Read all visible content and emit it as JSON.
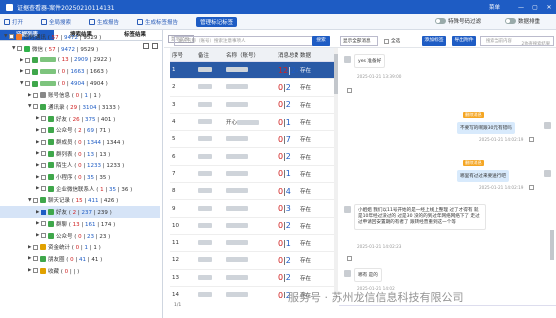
{
  "window": {
    "title": "证据查看器-案件20250210114131",
    "menu": "菜单",
    "min": "—",
    "max": "▢",
    "close": "✕"
  },
  "toolbar": {
    "items": [
      {
        "label": "打开"
      },
      {
        "label": "全局搜索"
      },
      {
        "label": "生成报告"
      },
      {
        "label": "生成标签报告"
      },
      {
        "label": "管理标记标签"
      }
    ],
    "toggle1": "特殊号码过滤",
    "toggle2": "数据排重"
  },
  "left": {
    "tabs": [
      "证据列表",
      "搜索结果",
      "标签结果"
    ],
    "tree": [
      {
        "name": "即时通讯",
        "a": "57",
        "b": "9472",
        "c": "9529",
        "lvl": 1,
        "open": true
      },
      {
        "name": "微信",
        "a": "57",
        "b": "9472",
        "c": "9529",
        "lvl": 2,
        "open": true
      },
      {
        "name": "",
        "a": "13",
        "b": "2909",
        "c": "2922",
        "lvl": 3
      },
      {
        "name": "",
        "a": "0",
        "b": "1663",
        "c": "1663",
        "lvl": 3
      },
      {
        "name": "",
        "a": "0",
        "b": "4904",
        "c": "4904",
        "lvl": 3,
        "open": true
      },
      {
        "name": "账号信息",
        "a": "0",
        "b": "1",
        "c": "1",
        "lvl": 4
      },
      {
        "name": "通讯录",
        "a": "29",
        "b": "3104",
        "c": "3133",
        "lvl": 4,
        "open": true
      },
      {
        "name": "好友",
        "a": "26",
        "b": "375",
        "c": "401",
        "lvl": 5
      },
      {
        "name": "公众号",
        "a": "2",
        "b": "69",
        "c": "71",
        "lvl": 5
      },
      {
        "name": "群成员",
        "a": "0",
        "b": "1344",
        "c": "1344",
        "lvl": 5
      },
      {
        "name": "群列表",
        "a": "0",
        "b": "13",
        "c": "13",
        "lvl": 5
      },
      {
        "name": "陌生人",
        "a": "0",
        "b": "1233",
        "c": "1233",
        "lvl": 5
      },
      {
        "name": "小程序",
        "a": "0",
        "b": "35",
        "c": "35",
        "lvl": 5
      },
      {
        "name": "企业微信联系人",
        "a": "1",
        "b": "35",
        "c": "36",
        "lvl": 5
      },
      {
        "name": "聊天记录",
        "a": "15",
        "b": "411",
        "c": "426",
        "lvl": 4,
        "open": true
      },
      {
        "name": "好友",
        "a": "2",
        "b": "237",
        "c": "239",
        "lvl": 5,
        "sel": true
      },
      {
        "name": "群聊",
        "a": "13",
        "b": "161",
        "c": "174",
        "lvl": 5
      },
      {
        "name": "公众号",
        "a": "0",
        "b": "23",
        "c": "23",
        "lvl": 5
      },
      {
        "name": "资金统计",
        "a": "0",
        "b": "1",
        "c": "1",
        "lvl": 4
      },
      {
        "name": "朋友圈",
        "a": "0",
        "b": "41",
        "c": "41",
        "lvl": 4
      },
      {
        "name": "收藏",
        "a": "0",
        "b": "",
        "c": "",
        "lvl": 4
      }
    ]
  },
  "main": {
    "segment": "显示全部",
    "search_placeholder": "输入名称（账号）搜索注意事项人",
    "search_btn": "搜索",
    "show_all": "显示全部消息",
    "select_all": "全选",
    "add_tag": "添加标签",
    "export": "导出附件",
    "count_info": "2协查搜索结果",
    "chat_search_placeholder": "搜索当前内容",
    "columns": [
      "序号",
      "备注",
      "名称（账号）",
      "消息总数",
      "数据"
    ],
    "rows": [
      {
        "no": "1",
        "name": "",
        "total": "12",
        "total2": "24",
        "status": "存在"
      },
      {
        "no": "2",
        "name": "",
        "total": "0",
        "total2": "2",
        "status": "存在"
      },
      {
        "no": "3",
        "name": "",
        "total": "0",
        "total2": "2",
        "status": "存在"
      },
      {
        "no": "4",
        "name": "开心",
        "total": "0",
        "total2": "1",
        "status": "存在"
      },
      {
        "no": "5",
        "name": "",
        "total": "0",
        "total2": "7",
        "status": "存在"
      },
      {
        "no": "6",
        "name": "",
        "total": "0",
        "total2": "2",
        "status": "存在"
      },
      {
        "no": "7",
        "name": "",
        "total": "0",
        "total2": "1",
        "status": "存在"
      },
      {
        "no": "8",
        "name": "",
        "total": "0",
        "total2": "4",
        "status": "存在"
      },
      {
        "no": "9",
        "name": "",
        "total": "0",
        "total2": "3",
        "status": "存在"
      },
      {
        "no": "10",
        "name": "",
        "total": "0",
        "total2": "2",
        "status": "存在"
      },
      {
        "no": "11",
        "name": "",
        "total": "0",
        "total2": "1",
        "status": "存在"
      },
      {
        "no": "12",
        "name": "",
        "total": "0",
        "total2": "2",
        "status": "存在"
      },
      {
        "no": "13",
        "name": "",
        "total": "0",
        "total2": "2",
        "status": "存在"
      },
      {
        "no": "14",
        "name": "",
        "total": "0",
        "total2": "2",
        "status": "存在"
      }
    ],
    "pager": "1/1"
  },
  "chat": {
    "messages": [
      {
        "side": "left",
        "text": "yes 准备好",
        "time": "2025-01-21 13:39:00"
      },
      {
        "side": "right",
        "tag": "删除消息",
        "text": "不要写的啊跟30元有错吗",
        "time": "2025-01-21 14:02:19"
      },
      {
        "side": "right",
        "tag": "删除消息",
        "text": "哪里有过过来要送行吧",
        "time": "2025-01-21 14:02:19"
      },
      {
        "side": "left",
        "text": "小姐姐 我们以11号开始的是一经上线上整理 过了才得有 就是10年经过没过的 过是30 没的的到过年网络网络下了 走过过申请回安置期的有者了 跟转经营重到这一个等",
        "time": "2025-01-21 14:02:23"
      },
      {
        "side": "left",
        "text": "哪有 是的",
        "time": "2025-01-21 14:02"
      }
    ]
  },
  "watermark": "服务号 · 苏州龙信信息科技有限公司"
}
